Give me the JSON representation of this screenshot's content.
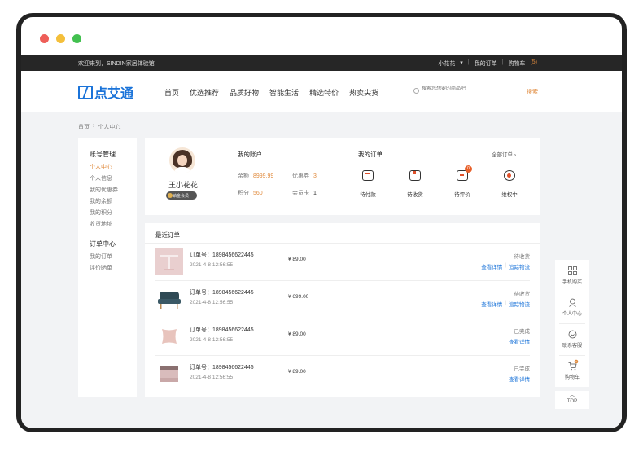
{
  "window": {
    "dots": [
      "#ee5e58",
      "#f4bf3a",
      "#42c04f"
    ]
  },
  "topbar": {
    "welcome": "欢迎来到，SINDIN家居体验馆",
    "user": "小花花",
    "my_orders": "我的订单",
    "cart": "购物车",
    "cart_count": "(5)"
  },
  "header": {
    "logo_text": "点艾通",
    "nav": [
      "首页",
      "优选推荐",
      "品质好物",
      "智能生活",
      "精选特价",
      "热卖尖货"
    ],
    "search_placeholder": "搜索您想要的商品吧",
    "search_button": "搜索"
  },
  "breadcrumb": {
    "home": "首页",
    "current": "个人中心"
  },
  "sidebar": {
    "group1_title": "账号管理",
    "group1_items": [
      "个人中心",
      "个人信息",
      "我的优惠券",
      "我的余额",
      "我的积分",
      "收货地址"
    ],
    "group2_title": "订单中心",
    "group2_items": [
      "我的订单",
      "评价晒单"
    ]
  },
  "account": {
    "user_name": "王小花花",
    "badge": "铂金会员",
    "title": "我的账户",
    "balance_label": "余额",
    "balance_value": "8999.99",
    "coupon_label": "优惠券",
    "coupon_value": "3",
    "points_label": "积分",
    "points_value": "560",
    "card_label": "会员卡",
    "card_value": "1"
  },
  "my_orders": {
    "title": "我的订单",
    "all_link": "全部订单 ›",
    "icons": [
      {
        "label": "待付款",
        "icon": "wallet-icon"
      },
      {
        "label": "待收货",
        "icon": "package-icon"
      },
      {
        "label": "待评价",
        "icon": "comment-icon",
        "badge": "0"
      },
      {
        "label": "维权中",
        "icon": "refund-icon"
      }
    ]
  },
  "recent": {
    "title": "最近订单",
    "rows": [
      {
        "order_label": "订单号：",
        "order_no": "1898456622445",
        "date": "2021-4-8 12:56:55",
        "price": "¥ 89.00",
        "status": "待收货",
        "link1": "查看详情",
        "link2": "追踪物流",
        "thumb": "table-icon"
      },
      {
        "order_label": "订单号：",
        "order_no": "1898456622445",
        "date": "2021-4-8 12:56:55",
        "price": "¥ 699.00",
        "status": "待收货",
        "link1": "查看详情",
        "link2": "追踪物流",
        "thumb": "armchair-icon"
      },
      {
        "order_label": "订单号：",
        "order_no": "1898456622445",
        "date": "2021-4-8 12:56:55",
        "price": "¥ 89.00",
        "status": "已完成",
        "link1": "查看详情",
        "link2": "",
        "thumb": "pillow-icon"
      },
      {
        "order_label": "订单号：",
        "order_no": "1898456622445",
        "date": "2021-4-8 12:56:55",
        "price": "¥ 89.00",
        "status": "已完成",
        "link1": "查看详情",
        "link2": "",
        "thumb": "bedding-icon"
      }
    ]
  },
  "floatbar": {
    "items": [
      "手机购买",
      "个人中心",
      "联系客服",
      "购物车"
    ],
    "cart_badge": "0",
    "top": "TOP"
  },
  "colors": {
    "accent": "#e08a3c",
    "brand": "#1a73d9",
    "link": "#1a73d9"
  }
}
